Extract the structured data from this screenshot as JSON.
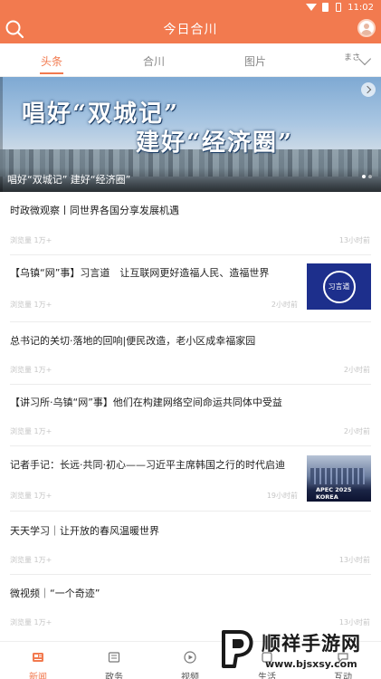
{
  "status_bar": {
    "time": "11:02"
  },
  "app_bar": {
    "title": "今日合川"
  },
  "tabs": [
    {
      "label": "头条",
      "active": true
    },
    {
      "label": "合川",
      "active": false
    },
    {
      "label": "图片",
      "active": false
    },
    {
      "label": "まさ",
      "active": false
    }
  ],
  "banner": {
    "headline_line1": "唱好“双城记”",
    "headline_line2": "建好“经济圈”",
    "caption": "唱好“双城记” 建好“经济圈”"
  },
  "news": [
    {
      "title": "时政微观察丨同世界各国分享发展机遇",
      "source": "浏览量 1万+",
      "time": "13小时前"
    },
    {
      "title": "【乌镇“网”事】习言道　让互联网更好造福人民、造福世界",
      "source": "浏览量 1万+",
      "time": "2小时前",
      "thumb": "xi"
    },
    {
      "title": "总书记的关切·落地的回响|便民改造，老小区成幸福家园",
      "source": "浏览量 1万+",
      "time": "2小时前"
    },
    {
      "title": "【讲习所·乌镇“网”事】他们在构建网络空间命运共同体中受益",
      "source": "浏览量 1万+",
      "time": "2小时前"
    },
    {
      "title": "记者手记：长远·共同·初心——习近平主席韩国之行的时代启迪",
      "source": "浏览量 1万+",
      "time": "19小时前",
      "thumb": "apec"
    },
    {
      "title": "天天学习｜让开放的春风温暖世界",
      "source": "浏览量 1万+",
      "time": "13小时前"
    },
    {
      "title": "微视频｜“一个奇迹”",
      "source": "浏览量 1万+",
      "time": "13小时前"
    }
  ],
  "thumbs": {
    "xi_seal": "习言道",
    "apec_text": "APEC 2025 KOREA"
  },
  "bottom_nav": [
    {
      "label": "新闻",
      "icon": "news-icon",
      "active": true
    },
    {
      "label": "政务",
      "icon": "government-icon",
      "active": false
    },
    {
      "label": "视频",
      "icon": "video-play-icon",
      "active": false
    },
    {
      "label": "生活",
      "icon": "life-icon",
      "active": false
    },
    {
      "label": "互动",
      "icon": "chat-icon",
      "active": false
    }
  ],
  "watermark": {
    "name": "顺祥手游网",
    "url": "www.bjsxsy.com"
  },
  "colors": {
    "accent": "#f27a4f",
    "thumb_blue": "#1d2f8c"
  }
}
